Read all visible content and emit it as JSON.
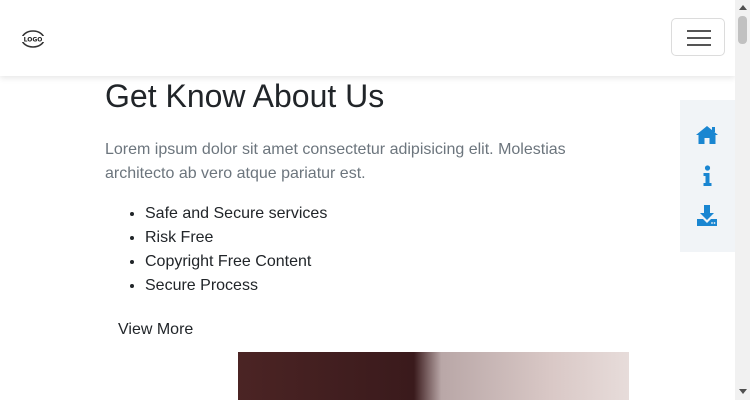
{
  "header": {
    "logo_text": "LOGO",
    "menu_icon": "hamburger-icon"
  },
  "about": {
    "title": "Get Know About Us",
    "description": "Lorem ipsum dolor sit amet consectetur adipisicing elit. Molestias architecto ab vero atque pariatur est.",
    "features": [
      "Safe and Secure services",
      "Risk Free",
      "Copyright Free Content",
      "Secure Process"
    ],
    "view_more": "View More"
  },
  "side_dock": {
    "icons": [
      "home-icon",
      "info-icon",
      "download-icon"
    ],
    "icon_color": "#1a86d1"
  },
  "colors": {
    "accent": "#1a86d1",
    "muted_text": "#6c757d",
    "dock_bg": "#f1f4f7"
  }
}
